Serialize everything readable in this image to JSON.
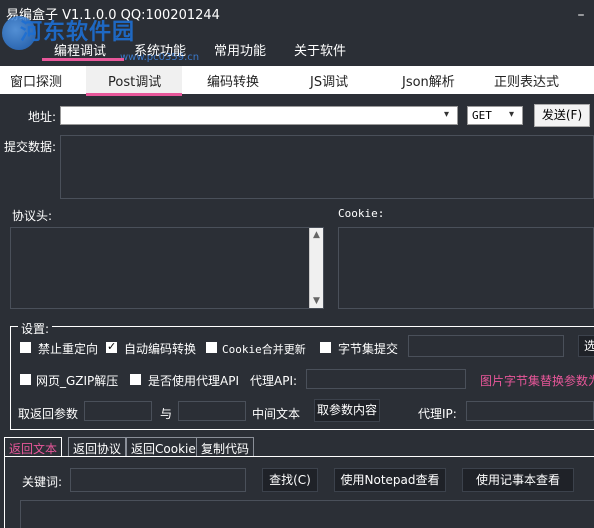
{
  "window": {
    "title": "易编盒子 V1.1.0.0 QQ:100201244",
    "minimize_glyph": "–",
    "watermark": "河东软件园",
    "watermark_url": "www.pc0359.cn"
  },
  "top_menu": {
    "items": [
      "编程调试",
      "系统功能",
      "常用功能",
      "关于软件"
    ],
    "active_index": 0
  },
  "sub_tabs": {
    "items": [
      "窗口探测",
      "Post调试",
      "编码转换",
      "JS调试",
      "Json解析",
      "正则表达式"
    ],
    "active_index": 1
  },
  "form": {
    "address_label": "地址:",
    "address_value": "",
    "method_value": "GET",
    "send_button": "发送(F)",
    "submit_data_label": "提交数据:",
    "headers_label": "协议头:",
    "cookie_label": "Cookie:"
  },
  "settings": {
    "group_label": "设置:",
    "no_redirect": "禁止重定向",
    "auto_encoding": "自动编码转换",
    "cookie_merge": "Cookie合并更新",
    "charset_submit": "字节集提交",
    "gzip_decompress": "网页_GZIP解压",
    "use_proxy_api": "是否使用代理API",
    "proxy_api_label": "代理API:",
    "image_charset_hint": "图片字节集替换参数为",
    "extract_label": "取返回参数",
    "and_label": "与",
    "middle_text_label": "中间文本",
    "extract_button": "取参数内容",
    "proxy_ip_label": "代理IP:",
    "trailing_button": "选"
  },
  "bottom_tabs": {
    "items": [
      "返回文本",
      "返回协议",
      "返回Cookie",
      "复制代码"
    ],
    "active_index": 0
  },
  "search": {
    "keyword_label": "关键词:",
    "find_button": "查找(C)",
    "notepad_button": "使用Notepad查看",
    "notebook_button": "使用记事本查看"
  },
  "colors": {
    "background": "#2b2f36",
    "accent": "#e8579a",
    "watermark": "#1d6fd3"
  }
}
